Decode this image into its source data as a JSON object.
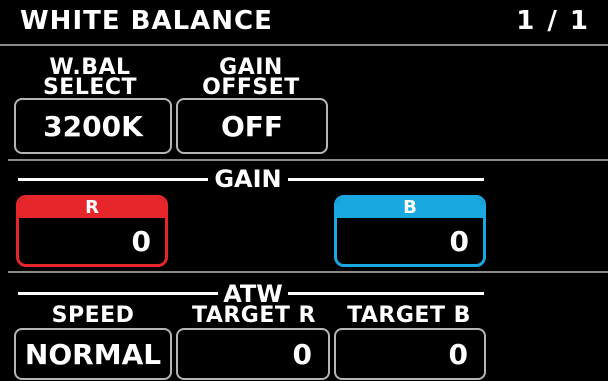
{
  "header": {
    "title": "WHITE BALANCE",
    "page": "1 / 1"
  },
  "top_controls": {
    "wbal_label_line1": "W.BAL",
    "wbal_label_line2": "SELECT",
    "wbal_value": "3200K",
    "gain_offset_label_line1": "GAIN",
    "gain_offset_label_line2": "OFFSET",
    "gain_offset_value": "OFF"
  },
  "gain": {
    "section_title": "GAIN",
    "r": {
      "label": "R",
      "value": "0",
      "color": "#e6262b"
    },
    "b": {
      "label": "B",
      "value": "0",
      "color": "#1aa8e0"
    }
  },
  "atw": {
    "section_title": "ATW",
    "speed_label": "SPEED",
    "speed_value": "NORMAL",
    "target_r_label": "TARGET R",
    "target_r_value": "0",
    "target_b_label": "TARGET B",
    "target_b_value": "0"
  }
}
